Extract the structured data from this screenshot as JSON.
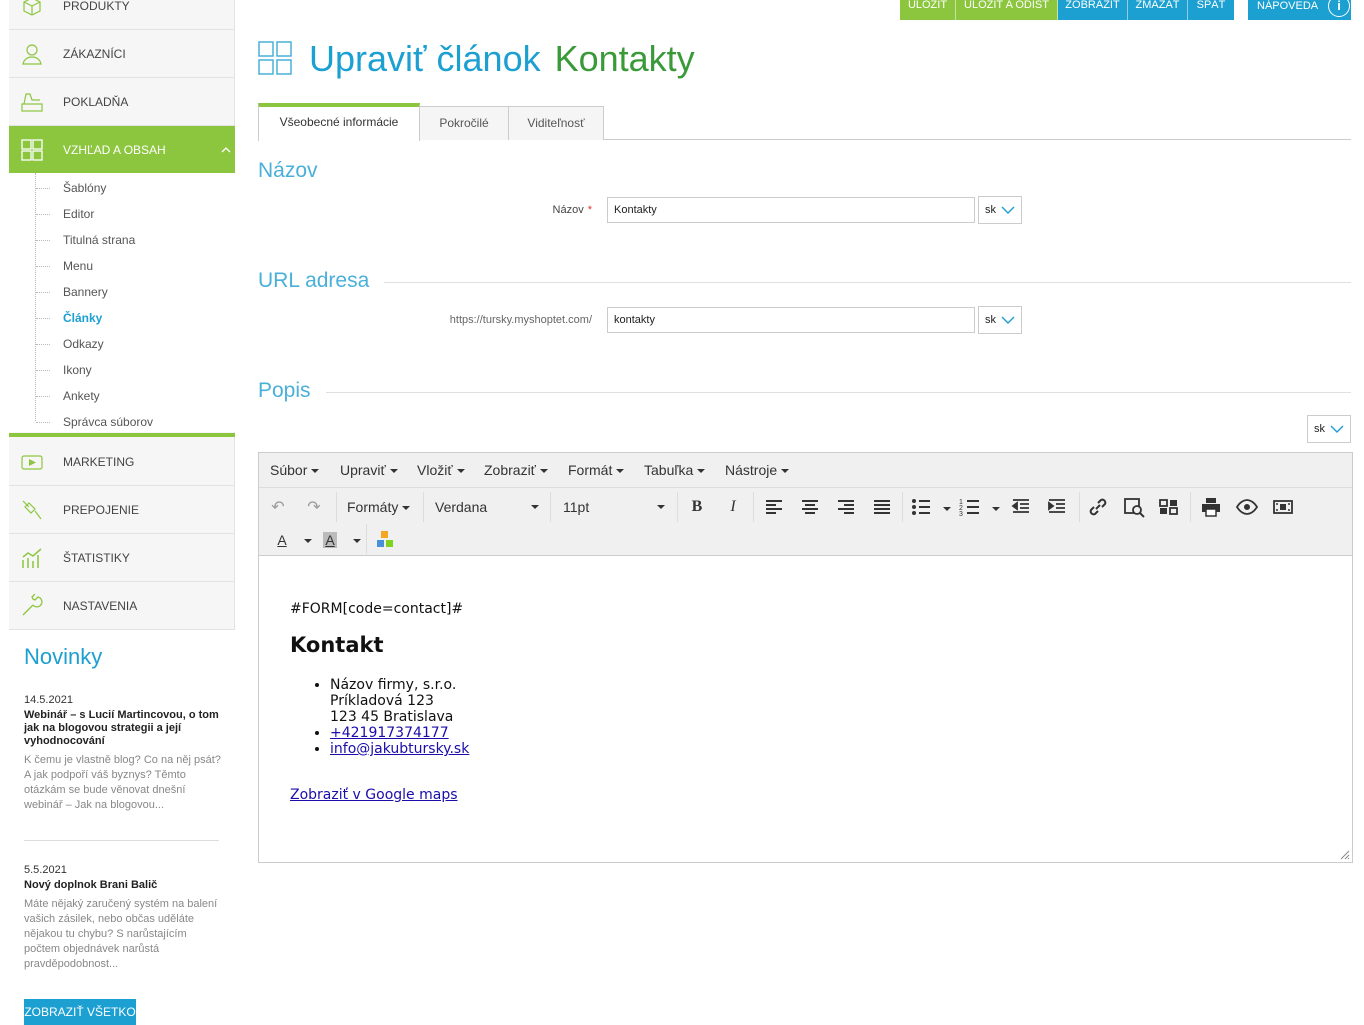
{
  "sidebar": {
    "items": [
      {
        "label": "PRODUKTY",
        "icon": "box-icon"
      },
      {
        "label": "ZÁKAZNÍCI",
        "icon": "user-icon"
      },
      {
        "label": "POKLADŇA",
        "icon": "cash-register-icon"
      },
      {
        "label": "VZHĽAD A OBSAH",
        "icon": "grid-icon"
      },
      {
        "label": "MARKETING",
        "icon": "megaphone-icon"
      },
      {
        "label": "PREPOJENIE",
        "icon": "plug-icon"
      },
      {
        "label": "ŠTATISTIKY",
        "icon": "chart-icon"
      },
      {
        "label": "NASTAVENIA",
        "icon": "wrench-icon"
      }
    ],
    "subitems": [
      "Šablóny",
      "Editor",
      "Titulná strana",
      "Menu",
      "Bannery",
      "Články",
      "Odkazy",
      "Ikony",
      "Ankety",
      "Správca súborov"
    ],
    "active_subitem": "Články"
  },
  "news": {
    "heading": "Novinky",
    "items": [
      {
        "date": "14.5.2021",
        "title": "Webinář – s Lucií Martincovou, o tom jak na blogovou strategii a její vyhodnocování",
        "text": "K čemu je vlastně blog? Co na něj psát? A jak podpoří váš byznys? Těmto otázkám se bude věnovat dnešní webinář  –  Jak na blogovou..."
      },
      {
        "date": "5.5.2021",
        "title": "Nový doplnok Brani Balič",
        "text": "Máte nějaký zaručený systém na balení vašich zásilek, nebo občas uděláte nějakou tu chybu? S narůstajícím počtem objednávek narůstá pravděpodobnost..."
      }
    ],
    "show_all": "ZOBRAZIŤ VŠETKO"
  },
  "topbar": {
    "save": "ULOŽIŤ",
    "save_leave": "ULOŽIŤ A ODÍSŤ",
    "show": "ZOBRAZIŤ",
    "delete": "ZMAZAŤ",
    "back": "SPÄŤ",
    "help": "NÁPOVEDA"
  },
  "page": {
    "title": "Upraviť článok",
    "subtitle": "Kontakty",
    "tabs": [
      "Všeobecné informácie",
      "Pokročilé",
      "Viditeľnosť"
    ]
  },
  "sections": {
    "name": {
      "title": "Názov",
      "label": "Názov",
      "required": "*",
      "value": "Kontakty",
      "lang": "sk"
    },
    "url": {
      "title": "URL adresa",
      "prefix": "https://tursky.myshoptet.com/",
      "value": "kontakty",
      "lang": "sk"
    },
    "desc": {
      "title": "Popis",
      "lang": "sk"
    }
  },
  "editor": {
    "menus": [
      "Súbor",
      "Upraviť",
      "Vložiť",
      "Zobraziť",
      "Formát",
      "Tabuľka",
      "Nástroje"
    ],
    "formats": "Formáty",
    "font": "Verdana",
    "size": "11pt",
    "content": {
      "form_code": "#FORM[code=contact]#",
      "heading": "Kontakt",
      "address_lines": [
        "Názov firmy, s.r.o.",
        "Príkladová 123",
        "123 45 Bratislava"
      ],
      "phone": "+421917374177",
      "email": "info@jakubtursky.sk",
      "maps_link": "Zobraziť v Google maps"
    }
  },
  "colors": {
    "green": "#8cc63f",
    "blue": "#1c9fd1"
  }
}
